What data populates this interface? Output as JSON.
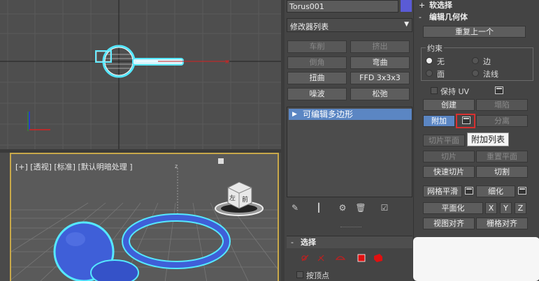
{
  "viewport_persp": {
    "label": "[+] [透视] [标准] [默认明暗处理 ]",
    "gizmo_front": "前",
    "gizmo_left": "左"
  },
  "object_name": "Torus001",
  "modifier_list": {
    "label": "修改器列表",
    "arrow": "▼"
  },
  "modifier_buttons": {
    "lathe": "车削",
    "extrude": "挤出",
    "chamfer": "倒角",
    "bend": "弯曲",
    "twist": "扭曲",
    "ffd": "FFD 3x3x3",
    "noise": "噪波",
    "relax": "松弛"
  },
  "stack": {
    "item": "可编辑多边形",
    "triangle": "▶"
  },
  "selection_section": {
    "label": "选择",
    "pm": "-"
  },
  "by_vertex_label": "按顶点",
  "right_panel": {
    "soft_select": {
      "label": "软选择",
      "pm": "+"
    },
    "edit_geometry": {
      "label": "编辑几何体",
      "pm": "-"
    },
    "repeat_last": "重复上一个",
    "constraint": {
      "title": "约束",
      "none": "无",
      "edge": "边",
      "face": "面",
      "normal": "法线"
    },
    "preserve_uv": "保持 UV",
    "create": "创建",
    "collapse": "塌陷",
    "attach": "附加",
    "detach": "分离",
    "slice_plane": "切片平面",
    "split": "分割",
    "slice": "切片",
    "reset_plane": "重置平面",
    "quick_slice": "快速切片",
    "cut": "切割",
    "meshsmooth": "网格平滑",
    "tessellate": "细化",
    "planarize": "平面化",
    "x": "X",
    "y": "Y",
    "z": "Z",
    "view_align": "视图对齐",
    "grid_align": "栅格对齐"
  },
  "tooltip": "附加列表",
  "colors": {
    "accent_blue": "#5b86c3",
    "swatch": "#5a5bd6",
    "highlight_red": "#d83030",
    "selection_cyan": "#55e8ff",
    "object_blue": "#3f5fd8"
  }
}
